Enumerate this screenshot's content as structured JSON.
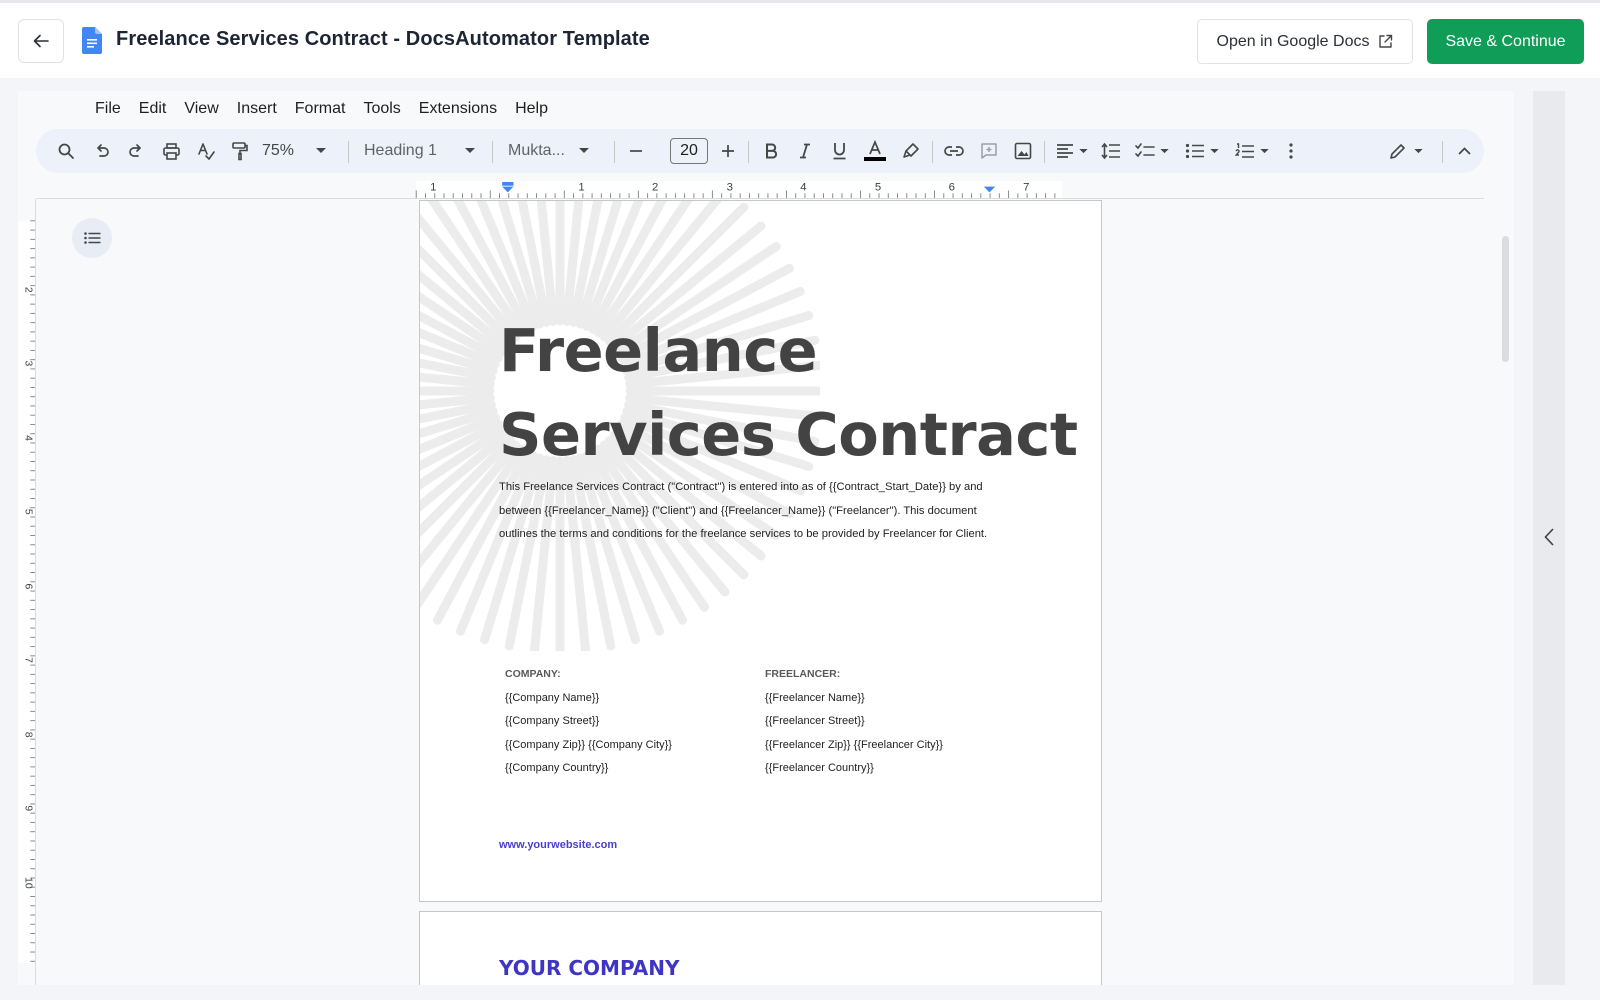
{
  "header": {
    "title": "Freelance Services Contract - DocsAutomator Template",
    "open_docs_label": "Open in Google Docs",
    "save_label": "Save & Continue",
    "accent_color": "#0f9d58"
  },
  "menu": [
    "File",
    "Edit",
    "View",
    "Insert",
    "Format",
    "Tools",
    "Extensions",
    "Help"
  ],
  "toolbar": {
    "zoom": "75%",
    "style": "Heading 1",
    "font": "Mukta...",
    "font_size": "20"
  },
  "ruler": {
    "horizontal": [
      "1",
      "1",
      "2",
      "3",
      "4",
      "5",
      "6",
      "7"
    ],
    "vertical": [
      "2",
      "3",
      "4",
      "5",
      "6",
      "7",
      "8",
      "9",
      "10"
    ]
  },
  "document": {
    "heading_line1": "Freelance",
    "heading_line2": "Services Contract",
    "intro_line1": "This Freelance Services Contract (\"Contract\") is entered into as of {{Contract_Start_Date}} by and",
    "intro_line2": "between {{Freelancer_Name}} (\"Client\") and {{Freelancer_Name}} (\"Freelancer\"). This document",
    "intro_line3": "outlines the terms and conditions for the freelance services to be provided by Freelancer for Client.",
    "company": {
      "heading": "COMPANY:",
      "name": "{{Company Name}}",
      "street": "{{Company Street}}",
      "zip_city": "{{Company Zip}} {{Company City}}",
      "country": "{{Company Country}}"
    },
    "freelancer": {
      "heading": "FREELANCER:",
      "name": "{{Freelancer Name}}",
      "street": "{{Freelancer Street}}",
      "zip_city": "{{Freelancer Zip}} {{Freelancer City}}",
      "country": "{{Freelancer Country}}"
    },
    "website": "www.yourwebsite.com",
    "page2_heading": "YOUR COMPANY"
  }
}
